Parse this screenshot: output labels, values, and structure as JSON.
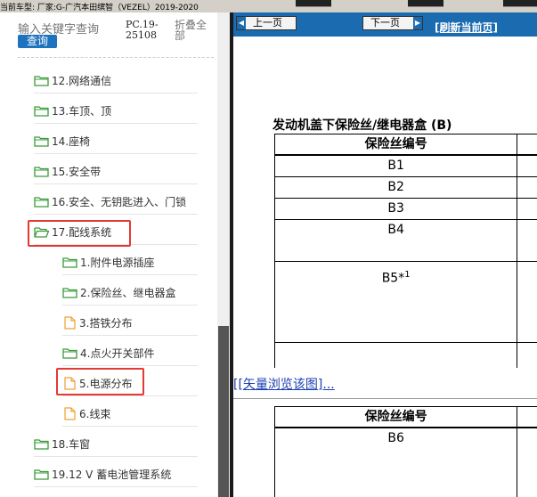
{
  "header": {
    "car_model": "当前车型:  厂家:G-广汽本田缤智（VEZEL）2019-2020"
  },
  "left_panel": {
    "search_placeholder": "输入关键字查询",
    "query_button": "查询",
    "pc_code": "PC.19-25108",
    "collapse_all": "折叠全部"
  },
  "tree": {
    "items": [
      {
        "label": "12.网络通信",
        "icon": "folder-icon"
      },
      {
        "label": "13.车顶、顶",
        "icon": "folder-icon"
      },
      {
        "label": "14.座椅",
        "icon": "folder-icon"
      },
      {
        "label": "15.安全带",
        "icon": "folder-icon"
      },
      {
        "label": "16.安全、无钥匙进入、门锁",
        "icon": "folder-icon"
      },
      {
        "label": "17.配线系统",
        "icon": "folder-open-icon"
      },
      {
        "label": "1.附件电源插座",
        "icon": "folder-icon"
      },
      {
        "label": "2.保险丝、继电器盒",
        "icon": "folder-icon"
      },
      {
        "label": "3.搭铁分布",
        "icon": "file-icon"
      },
      {
        "label": "4.点火开关部件",
        "icon": "folder-icon"
      },
      {
        "label": "5.电源分布",
        "icon": "file-icon"
      },
      {
        "label": "6.线束",
        "icon": "file-icon"
      },
      {
        "label": "18.车窗",
        "icon": "folder-icon"
      },
      {
        "label": "19.12 V 蓄电池管理系统",
        "icon": "folder-icon"
      }
    ]
  },
  "toolbar": {
    "prev_page": "上一页",
    "next_page": "下一页",
    "refresh": "[刷新当前页]"
  },
  "content": {
    "table_title": "发动机盖下保险丝/继电器盒 (B)",
    "column_header": "保险丝编号",
    "rows": [
      "B1",
      "B2",
      "B3",
      "B4",
      "B5*",
      "1"
    ],
    "vector_link_open": "[",
    "vector_link": "[矢量浏览该图]",
    "vector_link_tail": "...",
    "table2_header": "保险丝编号",
    "table2_row": "B6"
  },
  "colors": {
    "nav_blue": "#1a6bb0",
    "query_blue": "#1e73be",
    "highlight_red": "#e53935",
    "folder_green": "#3a9a3a",
    "file_orange": "#f0a030"
  }
}
